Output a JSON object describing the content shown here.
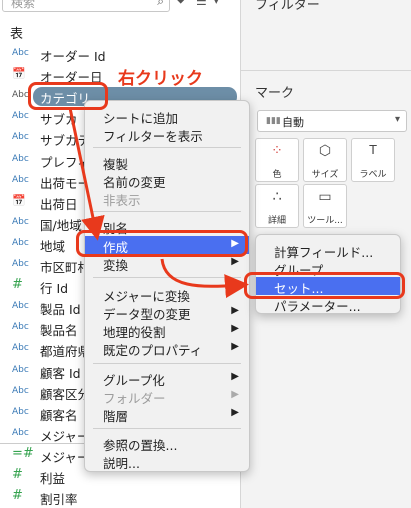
{
  "search": {
    "placeholder": "検索"
  },
  "data_pane": {
    "table_title": "表",
    "fields": [
      {
        "type": "Abc",
        "label": "オーダー Id"
      },
      {
        "type": "date",
        "label": "オーダー日"
      },
      {
        "type": "Abc",
        "label": "カテゴリ"
      },
      {
        "type": "Abc",
        "label": "サブカ"
      },
      {
        "type": "Abc",
        "label": "サブカテ"
      },
      {
        "type": "Abc",
        "label": "プレフィ"
      },
      {
        "type": "Abc",
        "label": "出荷モー"
      },
      {
        "type": "date",
        "label": "出荷日"
      },
      {
        "type": "Abc",
        "label": "国/地域"
      },
      {
        "type": "Abc",
        "label": "地域"
      },
      {
        "type": "Abc",
        "label": "市区町村"
      },
      {
        "type": "#",
        "label": "行 Id"
      },
      {
        "type": "Abc",
        "label": "製品 Id"
      },
      {
        "type": "Abc",
        "label": "製品名"
      },
      {
        "type": "Abc",
        "label": "都道府県"
      },
      {
        "type": "Abc",
        "label": "顧客 Id"
      },
      {
        "type": "Abc",
        "label": "顧客区分"
      },
      {
        "type": "Abc",
        "label": "顧客名"
      },
      {
        "type": "Abc",
        "label": "メジャー"
      },
      {
        "type": "=#",
        "label": "メジャー"
      },
      {
        "type": "#",
        "label": "利益"
      },
      {
        "type": "#",
        "label": "割引率"
      }
    ]
  },
  "right_pane": {
    "filters_title": "フィルター",
    "marks_title": "マーク",
    "mark_type": "自動",
    "mark_buttons": [
      {
        "icon": "⁘",
        "label": "色"
      },
      {
        "icon": "⬡",
        "label": "サイズ"
      },
      {
        "icon": "T",
        "label": "ラベル"
      },
      {
        "icon": "∴",
        "label": "詳細"
      },
      {
        "icon": "▭",
        "label": "ツール..."
      }
    ]
  },
  "annotation": {
    "right_click": "右クリック"
  },
  "context_menu": {
    "items": [
      {
        "label": "シートに追加"
      },
      {
        "label": "フィルターを表示"
      },
      {
        "label": "複製"
      },
      {
        "label": "名前の変更"
      },
      {
        "label": "非表示"
      },
      {
        "label": "別名"
      },
      {
        "label": "作成"
      },
      {
        "label": "変換"
      },
      {
        "label": "メジャーに変換"
      },
      {
        "label": "データ型の変更"
      },
      {
        "label": "地理的役割"
      },
      {
        "label": "既定のプロパティ"
      },
      {
        "label": "グループ化"
      },
      {
        "label": "フォルダー"
      },
      {
        "label": "階層"
      },
      {
        "label": "参照の置換..."
      },
      {
        "label": "説明..."
      }
    ]
  },
  "submenu": {
    "items": [
      {
        "label": "計算フィールド..."
      },
      {
        "label": "グループ..."
      },
      {
        "label": "セット..."
      },
      {
        "label": "パラメーター..."
      }
    ]
  },
  "colors": {
    "accent": "#e8391c",
    "highlight": "#4a6ff0",
    "pill": "#6d8ea7"
  }
}
